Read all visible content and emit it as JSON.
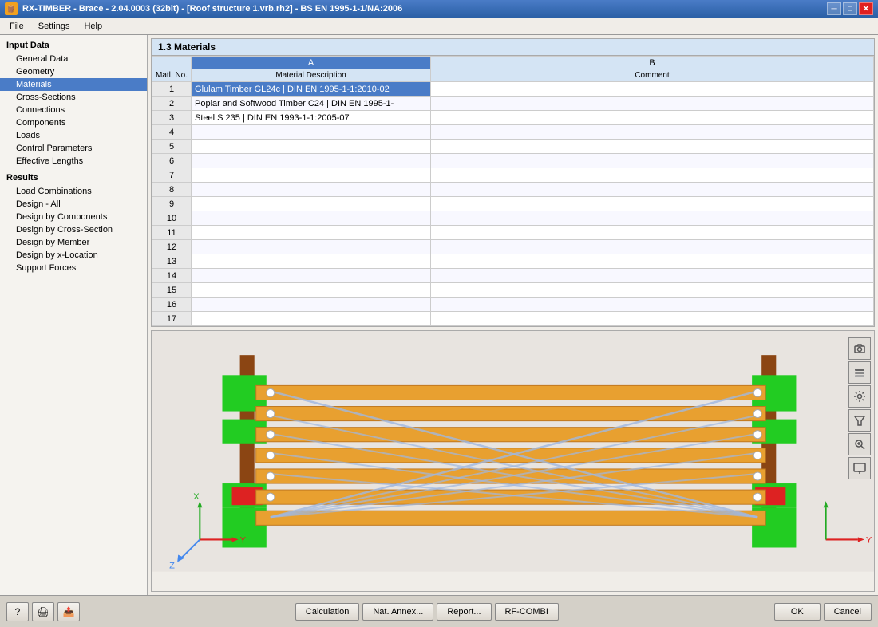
{
  "window": {
    "title": "RX-TIMBER - Brace - 2.04.0003 (32bit) - [Roof structure 1.vrb.rh2] - BS EN 1995-1-1/NA:2006"
  },
  "menu": {
    "items": [
      "File",
      "Settings",
      "Help"
    ]
  },
  "sidebar": {
    "section_input": "Input Data",
    "items_input": [
      {
        "id": "general-data",
        "label": "General Data",
        "active": false
      },
      {
        "id": "geometry",
        "label": "Geometry",
        "active": false
      },
      {
        "id": "materials",
        "label": "Materials",
        "active": true
      },
      {
        "id": "cross-sections",
        "label": "Cross-Sections",
        "active": false
      },
      {
        "id": "connections",
        "label": "Connections",
        "active": false
      },
      {
        "id": "components",
        "label": "Components",
        "active": false
      },
      {
        "id": "loads",
        "label": "Loads",
        "active": false
      },
      {
        "id": "control-parameters",
        "label": "Control Parameters",
        "active": false
      },
      {
        "id": "effective-lengths",
        "label": "Effective Lengths",
        "active": false
      }
    ],
    "section_results": "Results",
    "items_results": [
      {
        "id": "load-combinations",
        "label": "Load Combinations",
        "active": false
      },
      {
        "id": "design-all",
        "label": "Design - All",
        "active": false
      },
      {
        "id": "design-by-components",
        "label": "Design by Components",
        "active": false
      },
      {
        "id": "design-by-cross-section",
        "label": "Design by Cross-Section",
        "active": false
      },
      {
        "id": "design-by-member",
        "label": "Design by Member",
        "active": false
      },
      {
        "id": "design-by-x-location",
        "label": "Design by x-Location",
        "active": false
      },
      {
        "id": "support-forces",
        "label": "Support Forces",
        "active": false
      }
    ]
  },
  "main": {
    "section_title": "1.3 Materials",
    "table": {
      "col_a_header": "A",
      "col_b_header": "B",
      "col_matl_no": "Matl. No.",
      "col_material_desc": "Material Description",
      "col_comment": "Comment",
      "rows": [
        {
          "no": 1,
          "material": "Glulam Timber GL24c | DIN EN 1995-1-1:2010-02",
          "comment": "",
          "active": true
        },
        {
          "no": 2,
          "material": "Poplar and Softwood Timber C24 | DIN EN 1995-1-",
          "comment": ""
        },
        {
          "no": 3,
          "material": "Steel S 235 | DIN EN 1993-1-1:2005-07",
          "comment": ""
        },
        {
          "no": 4,
          "material": "",
          "comment": ""
        },
        {
          "no": 5,
          "material": "",
          "comment": ""
        },
        {
          "no": 6,
          "material": "",
          "comment": ""
        },
        {
          "no": 7,
          "material": "",
          "comment": ""
        },
        {
          "no": 8,
          "material": "",
          "comment": ""
        },
        {
          "no": 9,
          "material": "",
          "comment": ""
        },
        {
          "no": 10,
          "material": "",
          "comment": ""
        },
        {
          "no": 11,
          "material": "",
          "comment": ""
        },
        {
          "no": 12,
          "material": "",
          "comment": ""
        },
        {
          "no": 13,
          "material": "",
          "comment": ""
        },
        {
          "no": 14,
          "material": "",
          "comment": ""
        },
        {
          "no": 15,
          "material": "",
          "comment": ""
        },
        {
          "no": 16,
          "material": "",
          "comment": ""
        },
        {
          "no": 17,
          "material": "",
          "comment": ""
        }
      ]
    }
  },
  "buttons": {
    "calculation": "Calculation",
    "nat_annex": "Nat. Annex...",
    "report": "Report...",
    "rf_combi": "RF-COMBI",
    "ok": "OK",
    "cancel": "Cancel"
  },
  "viewport_icons": {
    "camera": "📷",
    "layers": "📋",
    "settings": "🔧",
    "filter": "🔍",
    "zoom": "🔎",
    "display": "🖥"
  }
}
